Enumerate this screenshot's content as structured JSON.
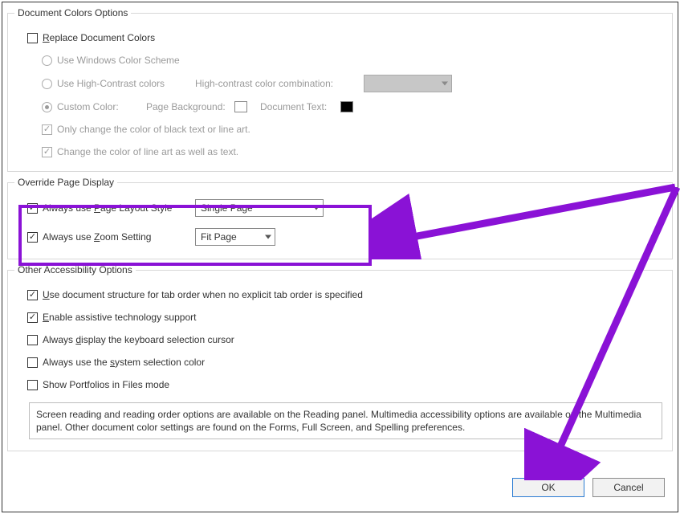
{
  "docColors": {
    "legend": "Document Colors Options",
    "replace": "Replace Document Colors",
    "winScheme": "Use Windows Color Scheme",
    "highContrast": "Use High-Contrast colors",
    "hcLabel": "High-contrast color combination:",
    "custom": "Custom Color:",
    "pageBg": "Page Background:",
    "docText": "Document Text:",
    "onlyBlack": "Only change the color of black text or line art.",
    "lineArt": "Change the color of line art as well as text."
  },
  "override": {
    "legend": "Override Page Display",
    "pageLayoutLabel_pre": "Always use ",
    "pageLayoutLabel_u": "P",
    "pageLayoutLabel_post": "age Layout Style",
    "pageLayoutValue": "Single Page",
    "zoomLabel_pre": "Always use ",
    "zoomLabel_u": "Z",
    "zoomLabel_post": "oom Setting",
    "zoomValue": "Fit Page"
  },
  "other": {
    "legend": "Other Accessibility Options",
    "tabOrder_pre": "",
    "tabOrder_u": "U",
    "tabOrder_post": "se document structure for tab order when no explicit tab order is specified",
    "assistive_pre": "",
    "assistive_u": "E",
    "assistive_post": "nable assistive technology support",
    "kbSel_pre": "Always ",
    "kbSel_u": "d",
    "kbSel_post": "isplay the keyboard selection cursor",
    "sysColor_pre": "Always use the ",
    "sysColor_u": "s",
    "sysColor_post": "ystem selection color",
    "portfolios": "Show Portfolios in Files mode",
    "info": "Screen reading and reading order options are available on the Reading panel. Multimedia accessibility options are available on the Multimedia panel. Other document color settings are found on the Forms, Full Screen, and Spelling preferences."
  },
  "buttons": {
    "ok": "OK",
    "cancel": "Cancel"
  },
  "replace_u": "R",
  "replace_post": "eplace Document Colors"
}
